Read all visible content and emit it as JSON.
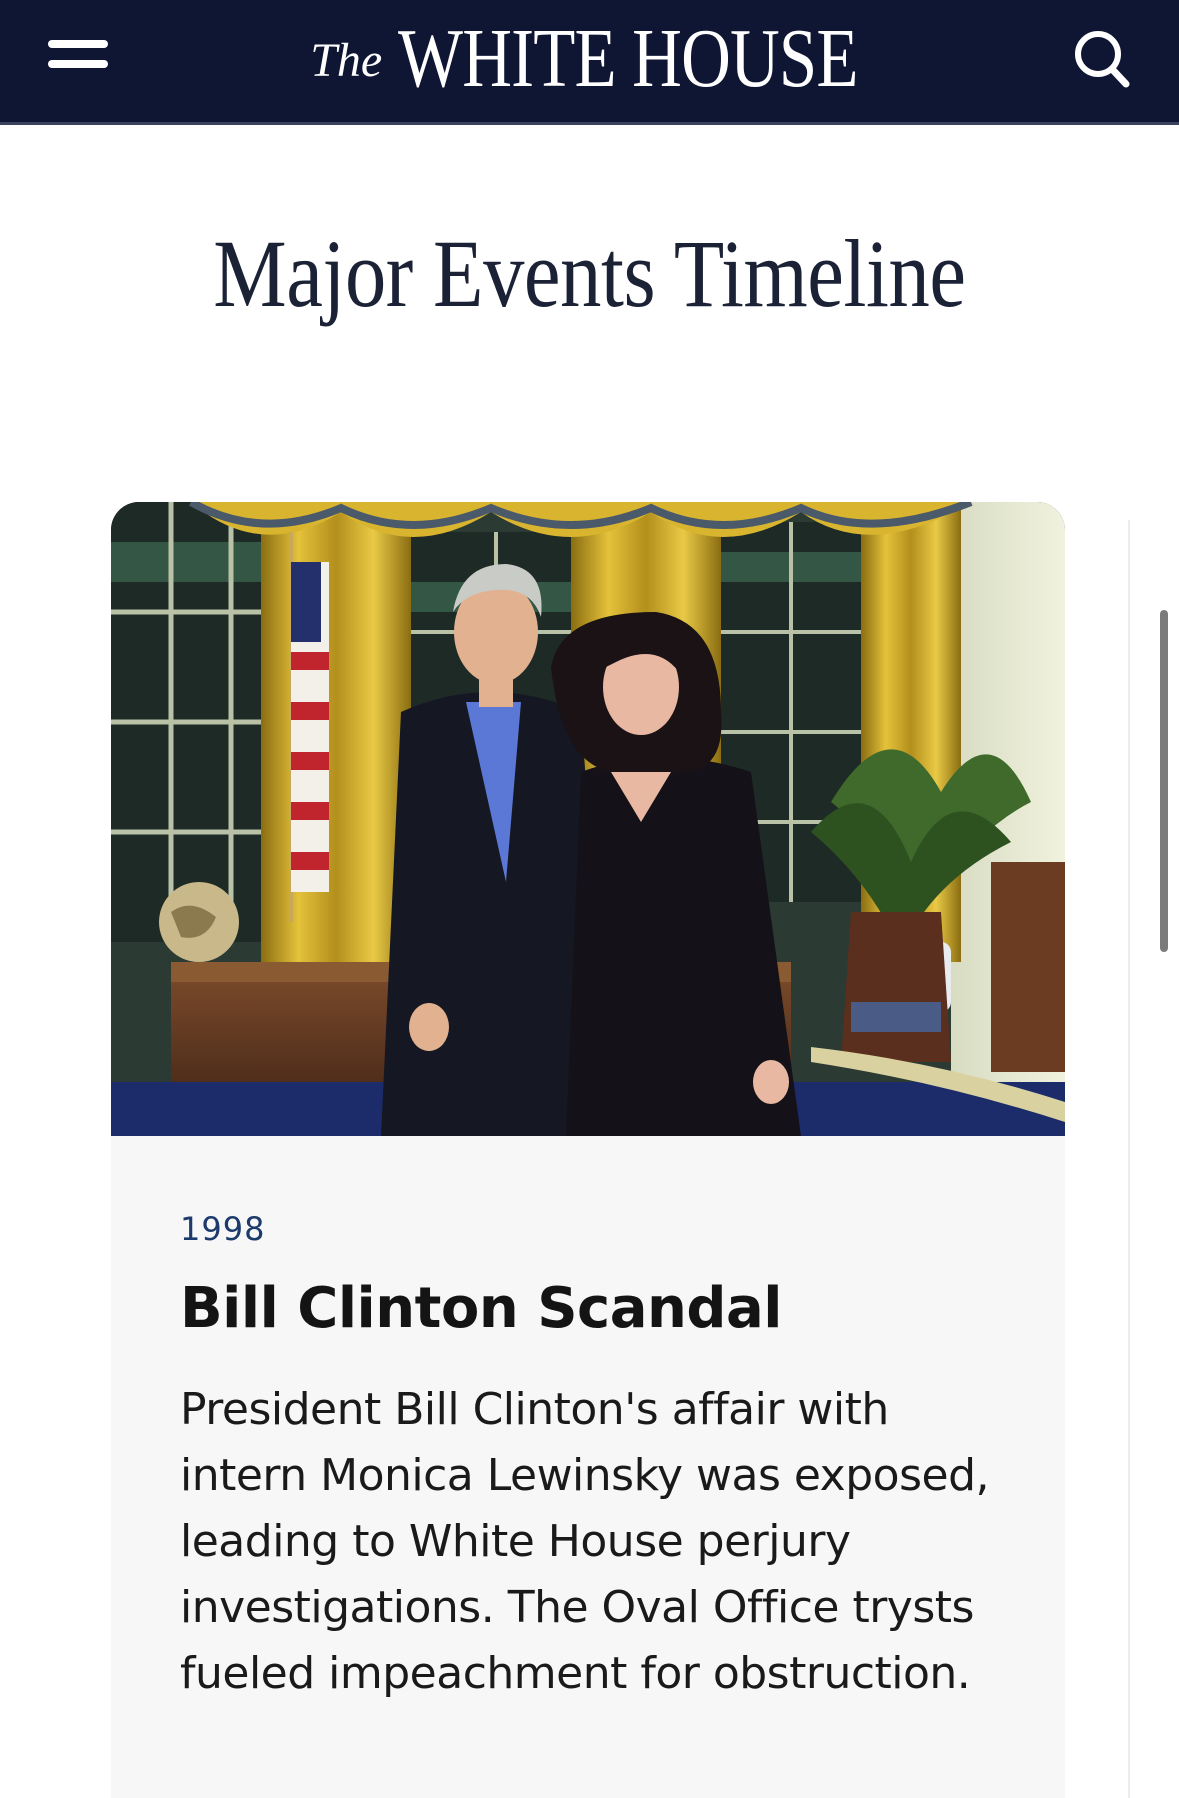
{
  "header": {
    "brand_prefix": "The",
    "brand_name": "WHITE HOUSE",
    "menu_icon": "hamburger-menu-icon",
    "search_icon": "search-icon",
    "background_color": "#0f1633"
  },
  "page": {
    "title": "Major Events Timeline"
  },
  "timeline": {
    "items": [
      {
        "photo_alt": "Bill Clinton and Monica Lewinsky posing in the Oval Office",
        "year": "1998",
        "title": "Bill Clinton Scandal",
        "description": "President Bill Clinton's affair with intern Monica Lewinsky was exposed, leading to White House perjury investigations. The Oval Office trysts fueled impeachment for obstruction."
      }
    ]
  },
  "colors": {
    "year_text": "#1c3a6b",
    "card_background": "#f7f7f7"
  }
}
